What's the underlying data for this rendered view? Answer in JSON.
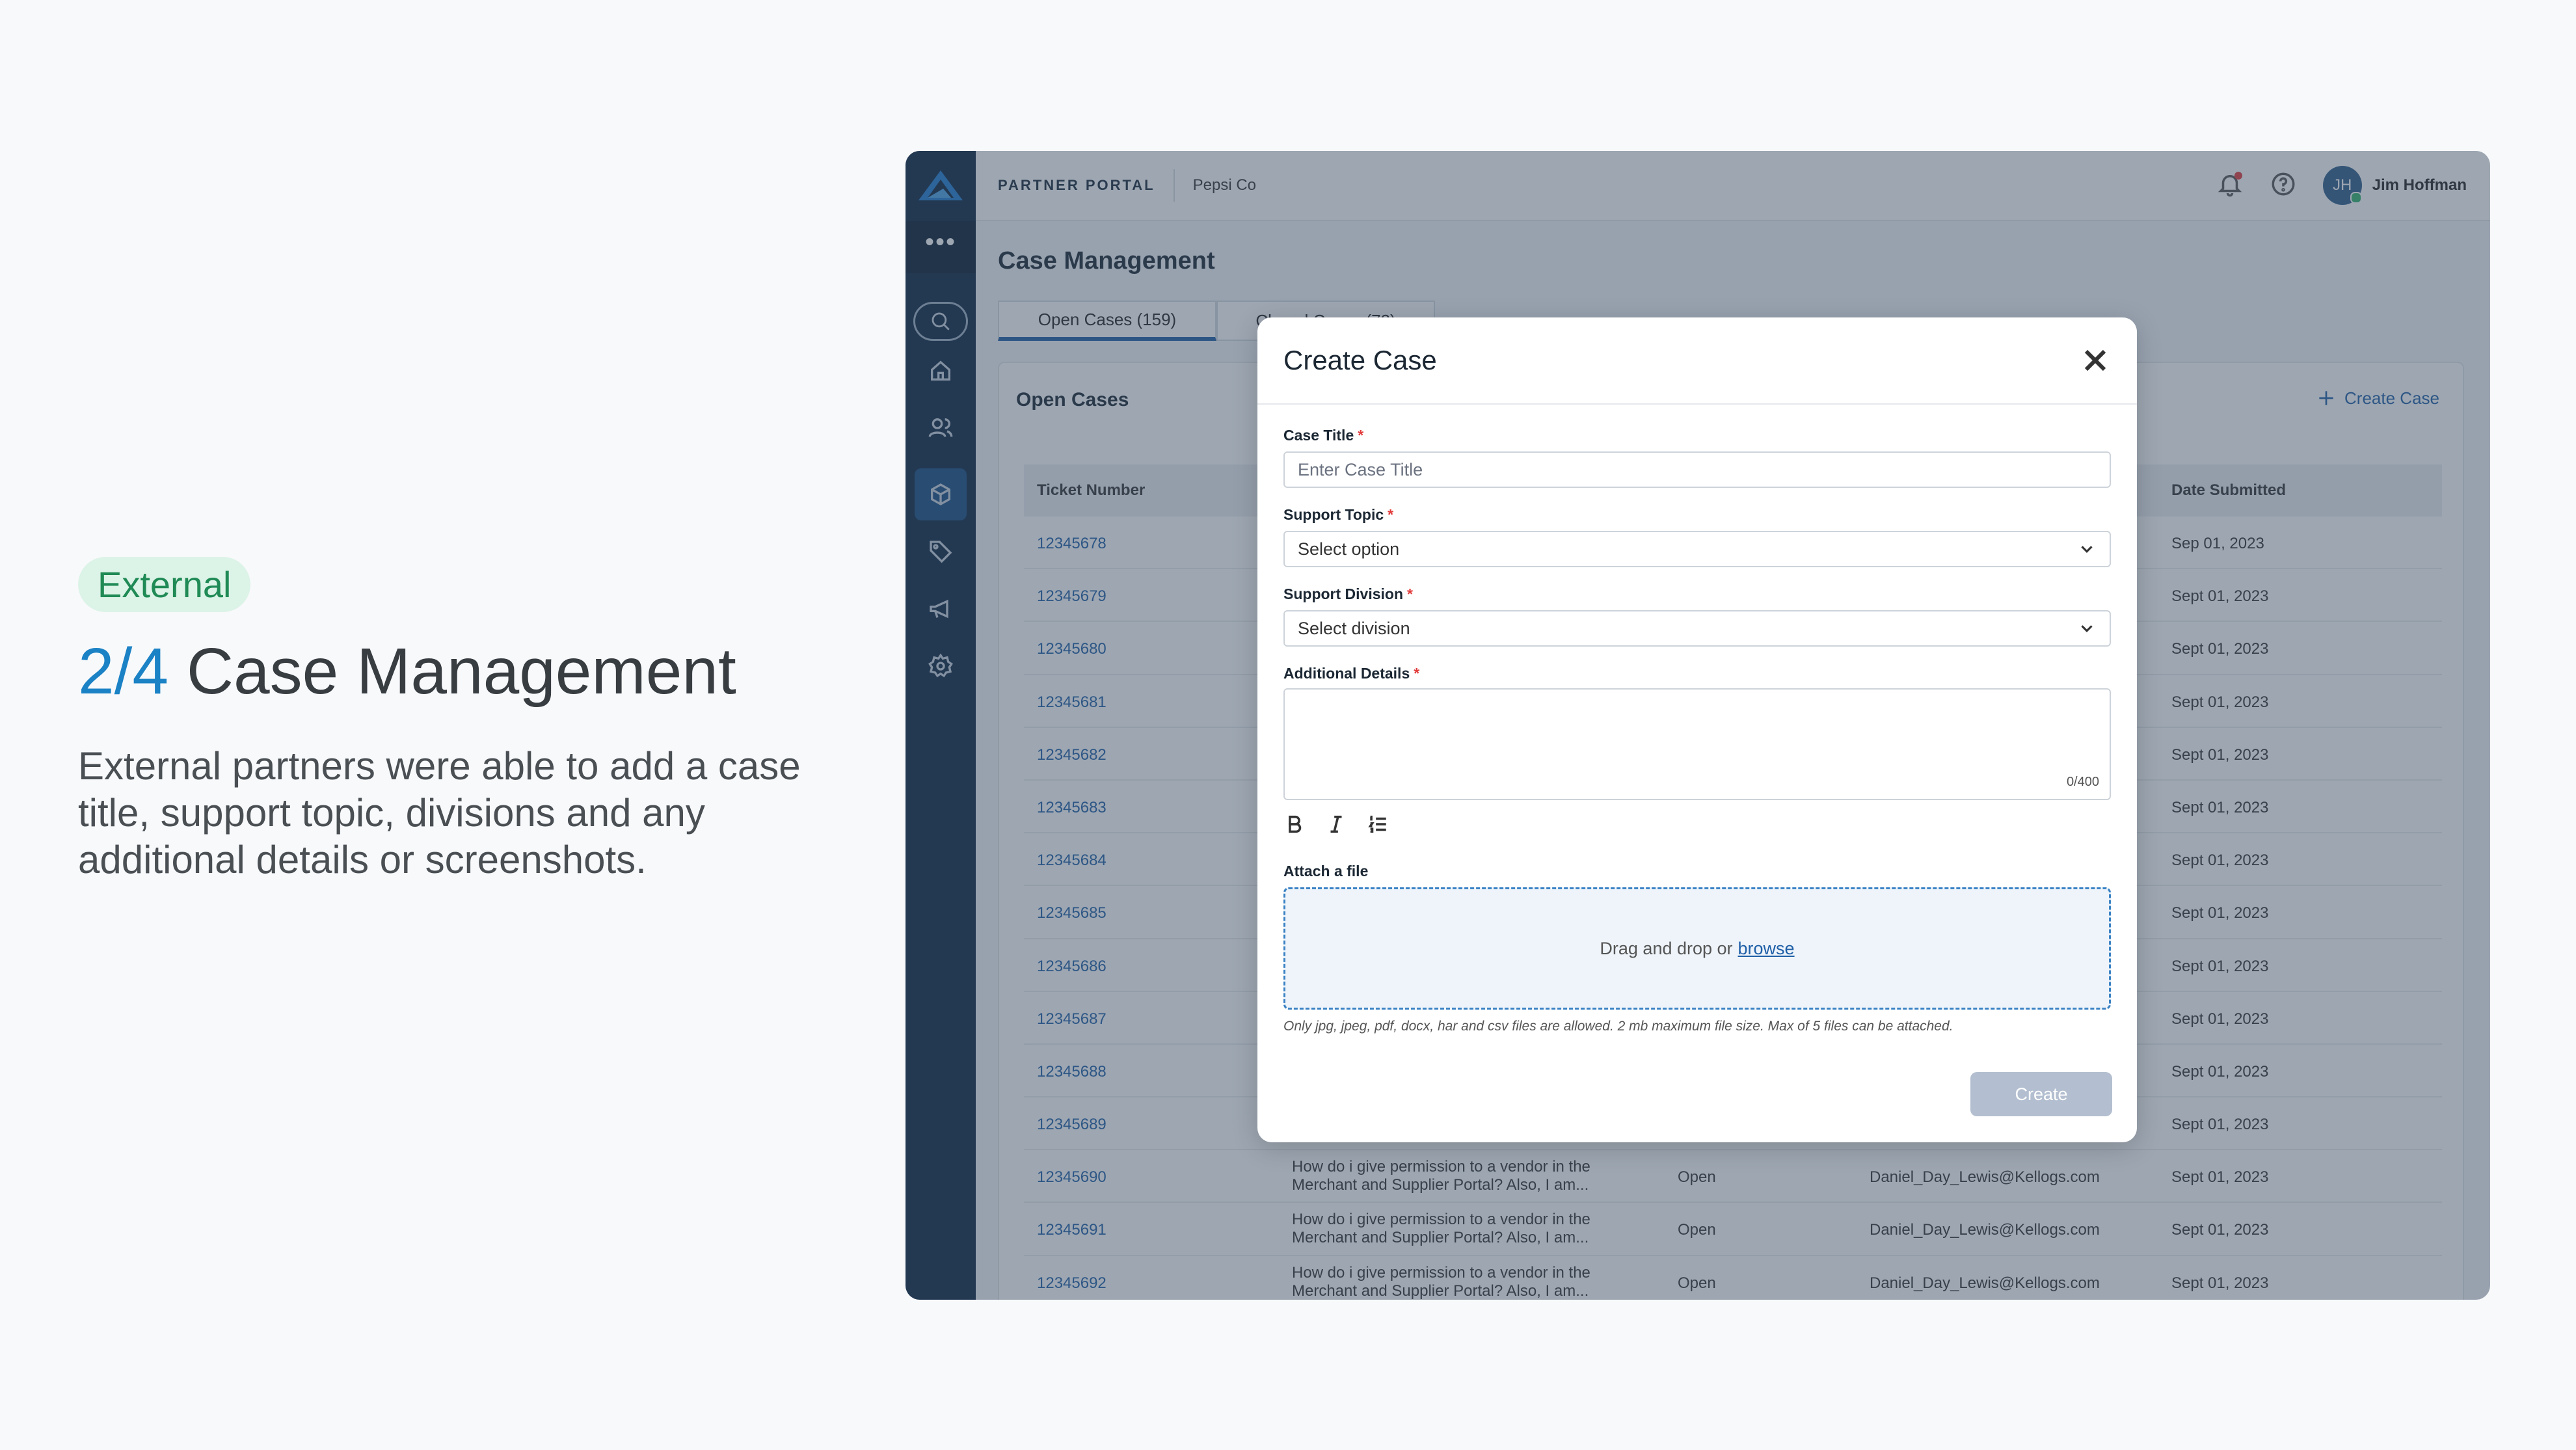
{
  "hero": {
    "badge": "External",
    "step": "2/4",
    "title": "Case Management",
    "description": "External partners were able to add a case title, support topic, divisions and any additional details or screenshots."
  },
  "topbar": {
    "portal": "PARTNER PORTAL",
    "company": "Pepsi Co",
    "avatar_initials": "JH",
    "user_name": "Jim Hoffman"
  },
  "page": {
    "title": "Case Management",
    "tabs": [
      "Open Cases (159)",
      "Closed Cases (72)"
    ],
    "panel_title": "Open Cases",
    "create_case": "Create Case"
  },
  "table": {
    "headers": {
      "ticket": "Ticket Number",
      "date": "Date Submitted"
    },
    "rows": [
      {
        "ticket": "12345678",
        "date": "Sep 01, 2023",
        "desc": "",
        "status": "",
        "email": ""
      },
      {
        "ticket": "12345679",
        "date": "Sept 01, 2023",
        "desc": "",
        "status": "",
        "email": ""
      },
      {
        "ticket": "12345680",
        "date": "Sept 01, 2023",
        "desc": "",
        "status": "",
        "email": ""
      },
      {
        "ticket": "12345681",
        "date": "Sept 01, 2023",
        "desc": "",
        "status": "",
        "email": ""
      },
      {
        "ticket": "12345682",
        "date": "Sept 01, 2023",
        "desc": "",
        "status": "",
        "email": ""
      },
      {
        "ticket": "12345683",
        "date": "Sept 01, 2023",
        "desc": "",
        "status": "",
        "email": ""
      },
      {
        "ticket": "12345684",
        "date": "Sept 01, 2023",
        "desc": "",
        "status": "",
        "email": ""
      },
      {
        "ticket": "12345685",
        "date": "Sept 01, 2023",
        "desc": "",
        "status": "",
        "email": ""
      },
      {
        "ticket": "12345686",
        "date": "Sept 01, 2023",
        "desc": "",
        "status": "",
        "email": ""
      },
      {
        "ticket": "12345687",
        "date": "Sept 01, 2023",
        "desc": "",
        "status": "",
        "email": ""
      },
      {
        "ticket": "12345688",
        "date": "Sept 01, 2023",
        "desc": "",
        "status": "",
        "email": ""
      },
      {
        "ticket": "12345689",
        "date": "Sept 01, 2023",
        "desc": "",
        "status": "",
        "email": ""
      },
      {
        "ticket": "12345690",
        "date": "Sept 01, 2023",
        "desc": "How do i give permission to a vendor in the Merchant and Supplier Portal? Also, I am...",
        "status": "Open",
        "email": "Daniel_Day_Lewis@Kellogs.com"
      },
      {
        "ticket": "12345691",
        "date": "Sept 01, 2023",
        "desc": "How do i give permission to a vendor in the Merchant and Supplier Portal? Also, I am...",
        "status": "Open",
        "email": "Daniel_Day_Lewis@Kellogs.com"
      },
      {
        "ticket": "12345692",
        "date": "Sept 01, 2023",
        "desc": "How do i give permission to a vendor in the Merchant and Supplier Portal? Also, I am...",
        "status": "Open",
        "email": "Daniel_Day_Lewis@Kellogs.com"
      }
    ]
  },
  "modal": {
    "title": "Create Case",
    "case_title_label": "Case Title",
    "case_title_placeholder": "Enter Case Title",
    "support_topic_label": "Support Topic",
    "support_topic_value": "Select option",
    "support_division_label": "Support Division",
    "support_division_value": "Select division",
    "details_label": "Additional Details",
    "details_counter": "0/400",
    "attach_label": "Attach a file",
    "drop_text": "Drag and drop or",
    "browse": "browse",
    "hint": "Only jpg, jpeg, pdf, docx, har and csv files are allowed. 2 mb maximum file size. Max of 5 files can be attached.",
    "create_button": "Create",
    "required_mark": "*"
  },
  "colors": {
    "accent": "#1f5fa7",
    "sidebar": "#0b2440",
    "badge_bg": "#dcf3e7",
    "badge_text": "#1f8a55",
    "step": "#1b82c5",
    "create_disabled": "#b3bfd0"
  }
}
